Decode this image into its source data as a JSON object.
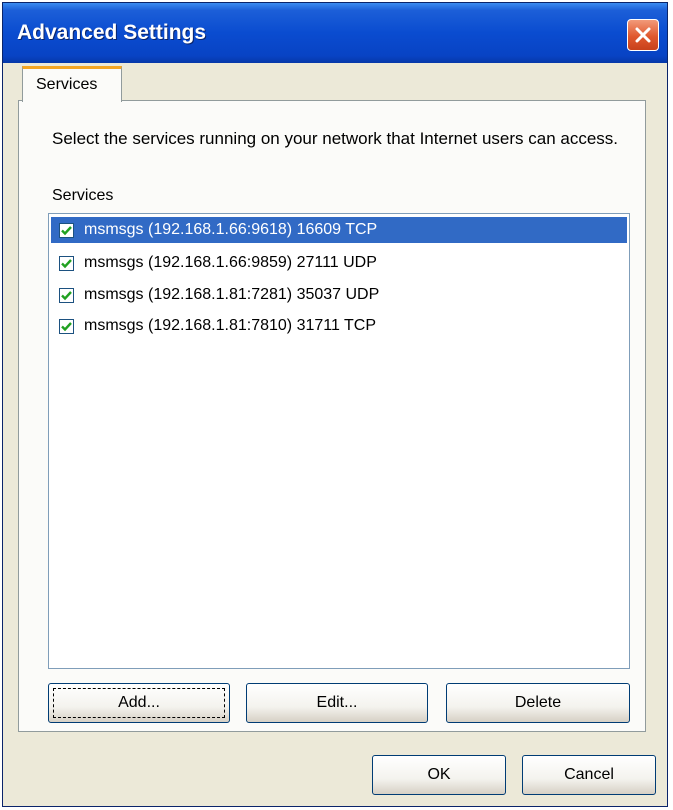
{
  "window": {
    "title": "Advanced Settings"
  },
  "tabs": [
    {
      "label": "Services"
    }
  ],
  "description": "Select the services running on your network that Internet users can access.",
  "services_label": "Services",
  "services": [
    {
      "label": "msmsgs (192.168.1.66:9618) 16609 TCP",
      "checked": true,
      "selected": true
    },
    {
      "label": "msmsgs (192.168.1.66:9859) 27111 UDP",
      "checked": true,
      "selected": false
    },
    {
      "label": "msmsgs (192.168.1.81:7281) 35037 UDP",
      "checked": true,
      "selected": false
    },
    {
      "label": "msmsgs (192.168.1.81:7810) 31711 TCP",
      "checked": true,
      "selected": false
    }
  ],
  "buttons": {
    "add": "Add...",
    "edit": "Edit...",
    "delete": "Delete",
    "ok": "OK",
    "cancel": "Cancel"
  },
  "colors": {
    "titlebar": "#0843c4",
    "selection": "#316ac5",
    "close": "#e0582e"
  }
}
